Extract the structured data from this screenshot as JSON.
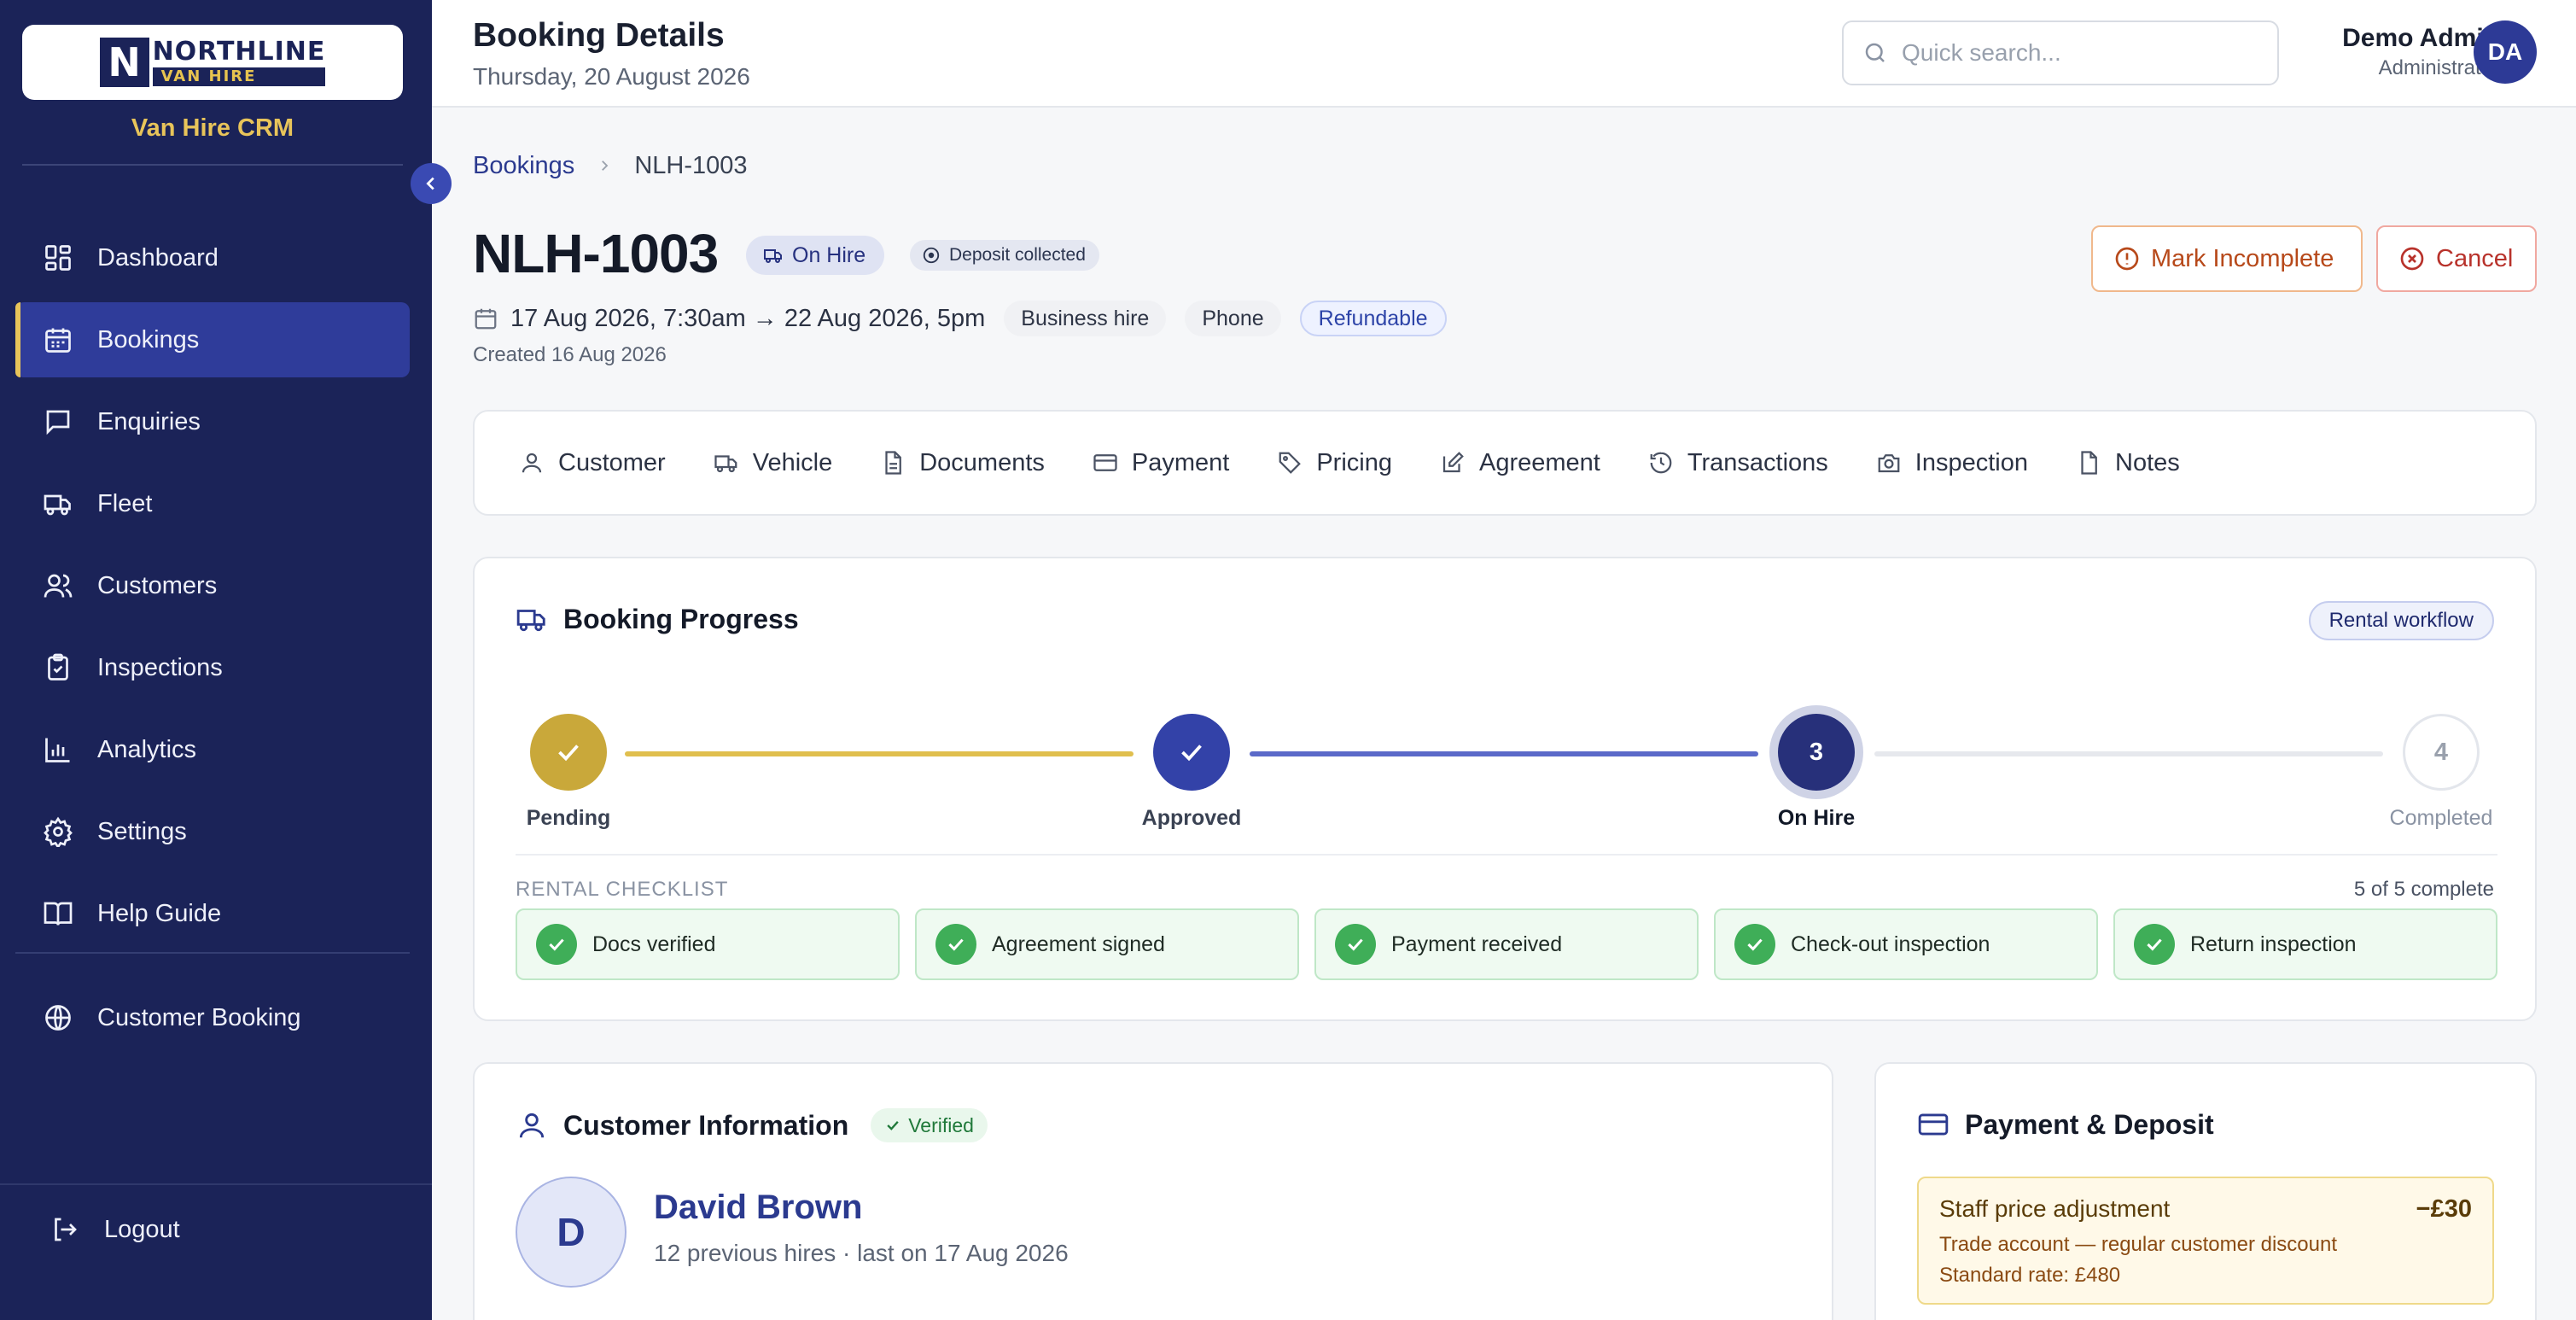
{
  "brand": {
    "logo_line1": "NORTHLINE",
    "logo_line2": "VAN HIRE",
    "app_name": "Van Hire CRM"
  },
  "sidebar": {
    "items": [
      {
        "label": "Dashboard",
        "icon": "dashboard-icon"
      },
      {
        "label": "Bookings",
        "icon": "calendar-icon",
        "active": true
      },
      {
        "label": "Enquiries",
        "icon": "chat-icon"
      },
      {
        "label": "Fleet",
        "icon": "truck-icon"
      },
      {
        "label": "Customers",
        "icon": "users-icon"
      },
      {
        "label": "Inspections",
        "icon": "clipboard-check-icon"
      },
      {
        "label": "Analytics",
        "icon": "bar-chart-icon"
      },
      {
        "label": "Settings",
        "icon": "gear-icon"
      },
      {
        "label": "Help Guide",
        "icon": "book-icon"
      }
    ],
    "external": {
      "label": "Customer Booking",
      "icon": "globe-icon"
    },
    "logout": "Logout"
  },
  "header": {
    "title": "Booking Details",
    "date": "Thursday, 20 August 2026",
    "search_placeholder": "Quick search...",
    "user_name": "Demo Admin",
    "user_role": "Administrator",
    "user_initials": "DA"
  },
  "breadcrumb": {
    "parent": "Bookings",
    "current": "NLH-1003"
  },
  "booking": {
    "id": "NLH-1003",
    "status": "On Hire",
    "deposit": "Deposit collected",
    "period": "17 Aug 2026, 7:30am → 22 Aug 2026, 5pm",
    "tags": [
      "Business hire",
      "Phone",
      "Refundable"
    ],
    "created": "Created 16 Aug 2026",
    "actions": {
      "mark_incomplete": "Mark Incomplete",
      "cancel": "Cancel"
    }
  },
  "tabs": [
    {
      "label": "Customer",
      "icon": "user-icon"
    },
    {
      "label": "Vehicle",
      "icon": "truck-icon"
    },
    {
      "label": "Documents",
      "icon": "document-icon"
    },
    {
      "label": "Payment",
      "icon": "credit-card-icon"
    },
    {
      "label": "Pricing",
      "icon": "tag-icon"
    },
    {
      "label": "Agreement",
      "icon": "edit-icon"
    },
    {
      "label": "Transactions",
      "icon": "history-icon"
    },
    {
      "label": "Inspection",
      "icon": "camera-icon"
    },
    {
      "label": "Notes",
      "icon": "note-icon"
    }
  ],
  "progress": {
    "title": "Booking Progress",
    "workflow": "Rental workflow",
    "steps": [
      {
        "label": "Pending",
        "state": "done",
        "color": "#c9a83a"
      },
      {
        "label": "Approved",
        "state": "done",
        "color": "#3342a8"
      },
      {
        "label": "On Hire",
        "number": "3",
        "state": "current",
        "color": "#27307a"
      },
      {
        "label": "Completed",
        "number": "4",
        "state": "future",
        "color": "#ffffff"
      }
    ],
    "checklist_title": "RENTAL CHECKLIST",
    "checklist_count": "5 of 5 complete",
    "checklist": [
      "Docs verified",
      "Agreement signed",
      "Payment received",
      "Check-out inspection",
      "Return inspection"
    ]
  },
  "customer": {
    "title": "Customer Information",
    "verified": "Verified",
    "initial": "D",
    "name": "David Brown",
    "summary": "12 previous hires · last on 17 Aug 2026"
  },
  "payment": {
    "title": "Payment & Deposit",
    "adjustment": {
      "title": "Staff price adjustment",
      "amount": "−£30",
      "note": "Trade account — regular customer discount",
      "standard_rate": "Standard rate: £480"
    }
  },
  "colors": {
    "sidebar_bg": "#1b2358",
    "accent": "#2f3c9a",
    "gold": "#e8c45a",
    "success": "#3fae58",
    "danger": "#b8322b"
  }
}
